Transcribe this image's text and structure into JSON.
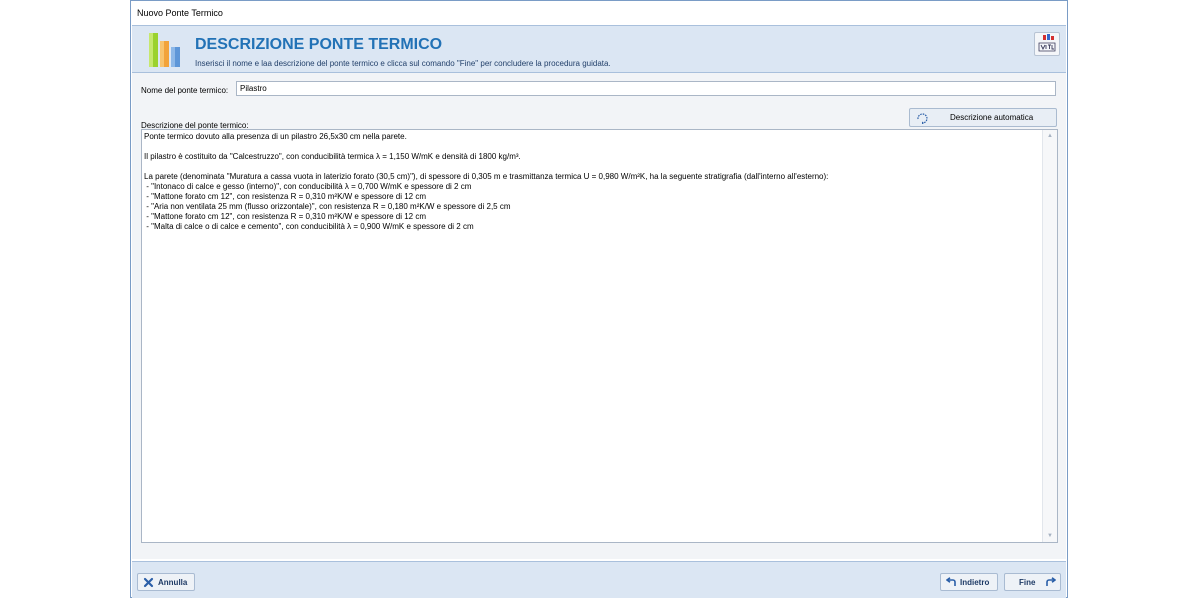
{
  "window": {
    "title": "Nuovo Ponte Termico"
  },
  "header": {
    "title": "DESCRIZIONE PONTE TERMICO",
    "subtitle": "Inserisci il nome e laa descrizione del ponte termico e clicca sul comando \"Fine\" per concludere la procedura guidata.",
    "logo_icon": "bar-chart-icon",
    "brand_icon": "brand-logo-icon"
  },
  "form": {
    "name_label": "Nome del ponte termico:",
    "name_value": "Pilastro",
    "desc_label": "Descrizione del ponte termico:",
    "auto_button": "Descrizione automatica",
    "auto_icon": "refresh-icon",
    "description_lines": [
      "Ponte termico dovuto alla presenza di un pilastro 26,5x30 cm nella parete.",
      "",
      "Il pilastro è costituito da \"Calcestruzzo\", con conducibilità termica λ = 1,150 W/mK e densità di 1800 kg/m³.",
      "",
      "La parete (denominata \"Muratura a cassa vuota in laterizio forato (30,5 cm)\"), di spessore di 0,305 m e trasmittanza termica U = 0,980 W/m²K, ha la seguente stratigrafia (dall'interno all'esterno):",
      " - \"Intonaco di calce e gesso (interno)\", con conducibilità λ = 0,700 W/mK e spessore di 2 cm",
      " - \"Mattone forato cm 12\", con resistenza R = 0,310 m²K/W e spessore di 12 cm",
      " - \"Aria non ventilata 25 mm (flusso orizzontale)\", con resistenza R = 0,180 m²K/W e spessore di 2,5 cm",
      " - \"Mattone forato cm 12\", con resistenza R = 0,310 m²K/W e spessore di 12 cm",
      " - \"Malta di calce o di calce e cemento\", con conducibilità λ = 0,900 W/mK e spessore di 2 cm"
    ]
  },
  "footer": {
    "cancel_label": "Annulla",
    "back_label": "Indietro",
    "finish_label": "Fine"
  },
  "colors": {
    "accent": "#2272b6",
    "header_bg": "#dbe6f3",
    "border": "#7a9cc6"
  }
}
